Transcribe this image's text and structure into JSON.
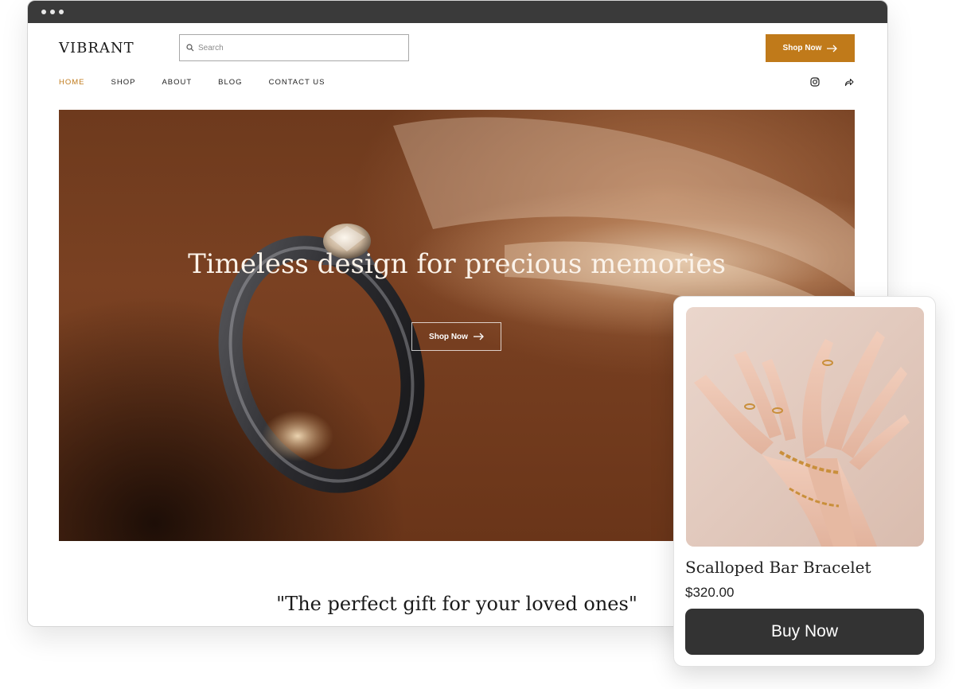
{
  "brand": {
    "logo": "VIBRANT",
    "accent_color": "#c07a1a"
  },
  "search": {
    "placeholder": "Search"
  },
  "header": {
    "shop_now_label": "Shop Now"
  },
  "nav": {
    "items": [
      {
        "label": "HOME",
        "active": true
      },
      {
        "label": "SHOP",
        "active": false
      },
      {
        "label": "ABOUT",
        "active": false
      },
      {
        "label": "BLOG",
        "active": false
      },
      {
        "label": "CONTACT US",
        "active": false
      }
    ],
    "social_icons": [
      "instagram-icon",
      "share-icon"
    ]
  },
  "hero": {
    "title": "Timeless design for precious memories",
    "button_label": "Shop Now"
  },
  "quote": "\"The perfect gift for your loved ones\"",
  "product_card": {
    "title": "Scalloped Bar Bracelet",
    "price": "$320.00",
    "button_label": "Buy Now"
  }
}
